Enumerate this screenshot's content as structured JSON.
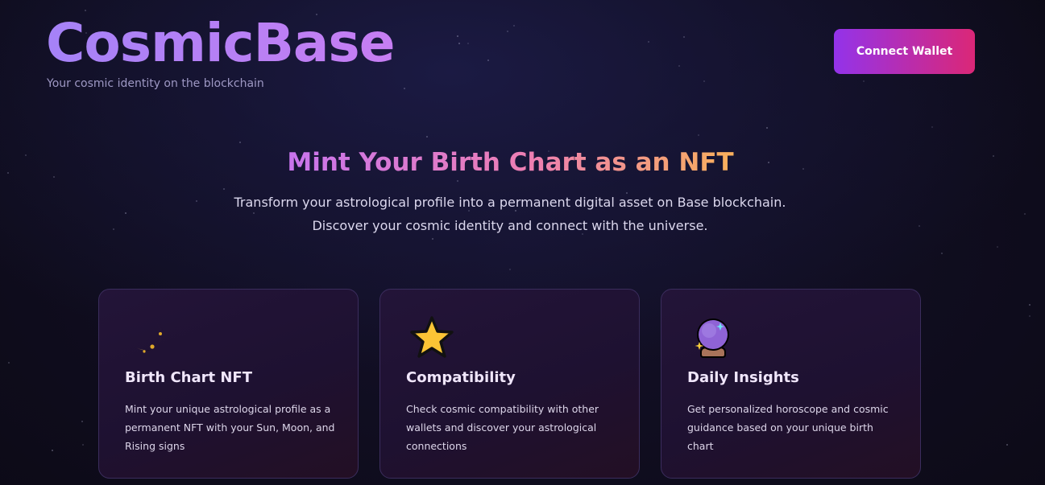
{
  "header": {
    "logo": "CosmicBase",
    "tagline": "Your cosmic identity on the blockchain",
    "connect_button": "Connect Wallet"
  },
  "hero": {
    "title": "Mint Your Birth Chart as an NFT",
    "subtitle": "Transform your astrological profile into a permanent digital asset on Base blockchain. Discover your cosmic identity and connect with the universe."
  },
  "features": [
    {
      "icon": "crescent-moon-icon",
      "title": "Birth Chart NFT",
      "description": "Mint your unique astrological profile as a permanent NFT with your Sun, Moon, and Rising signs"
    },
    {
      "icon": "star-icon",
      "title": "Compatibility",
      "description": "Check cosmic compatibility with other wallets and discover your astrological connections"
    },
    {
      "icon": "crystal-ball-icon",
      "title": "Daily Insights",
      "description": "Get personalized horoscope and cosmic guidance based on your unique birth chart"
    }
  ],
  "colors": {
    "background": "#0c0a16",
    "button_gradient_start": "#9333ea",
    "button_gradient_end": "#db2777",
    "logo_gradient_start": "#a582f7",
    "logo_gradient_end": "#c77ef3",
    "hero_gradient_start": "#c874ee",
    "hero_gradient_end": "#f8b05b",
    "card_border": "#3b2d5d"
  }
}
